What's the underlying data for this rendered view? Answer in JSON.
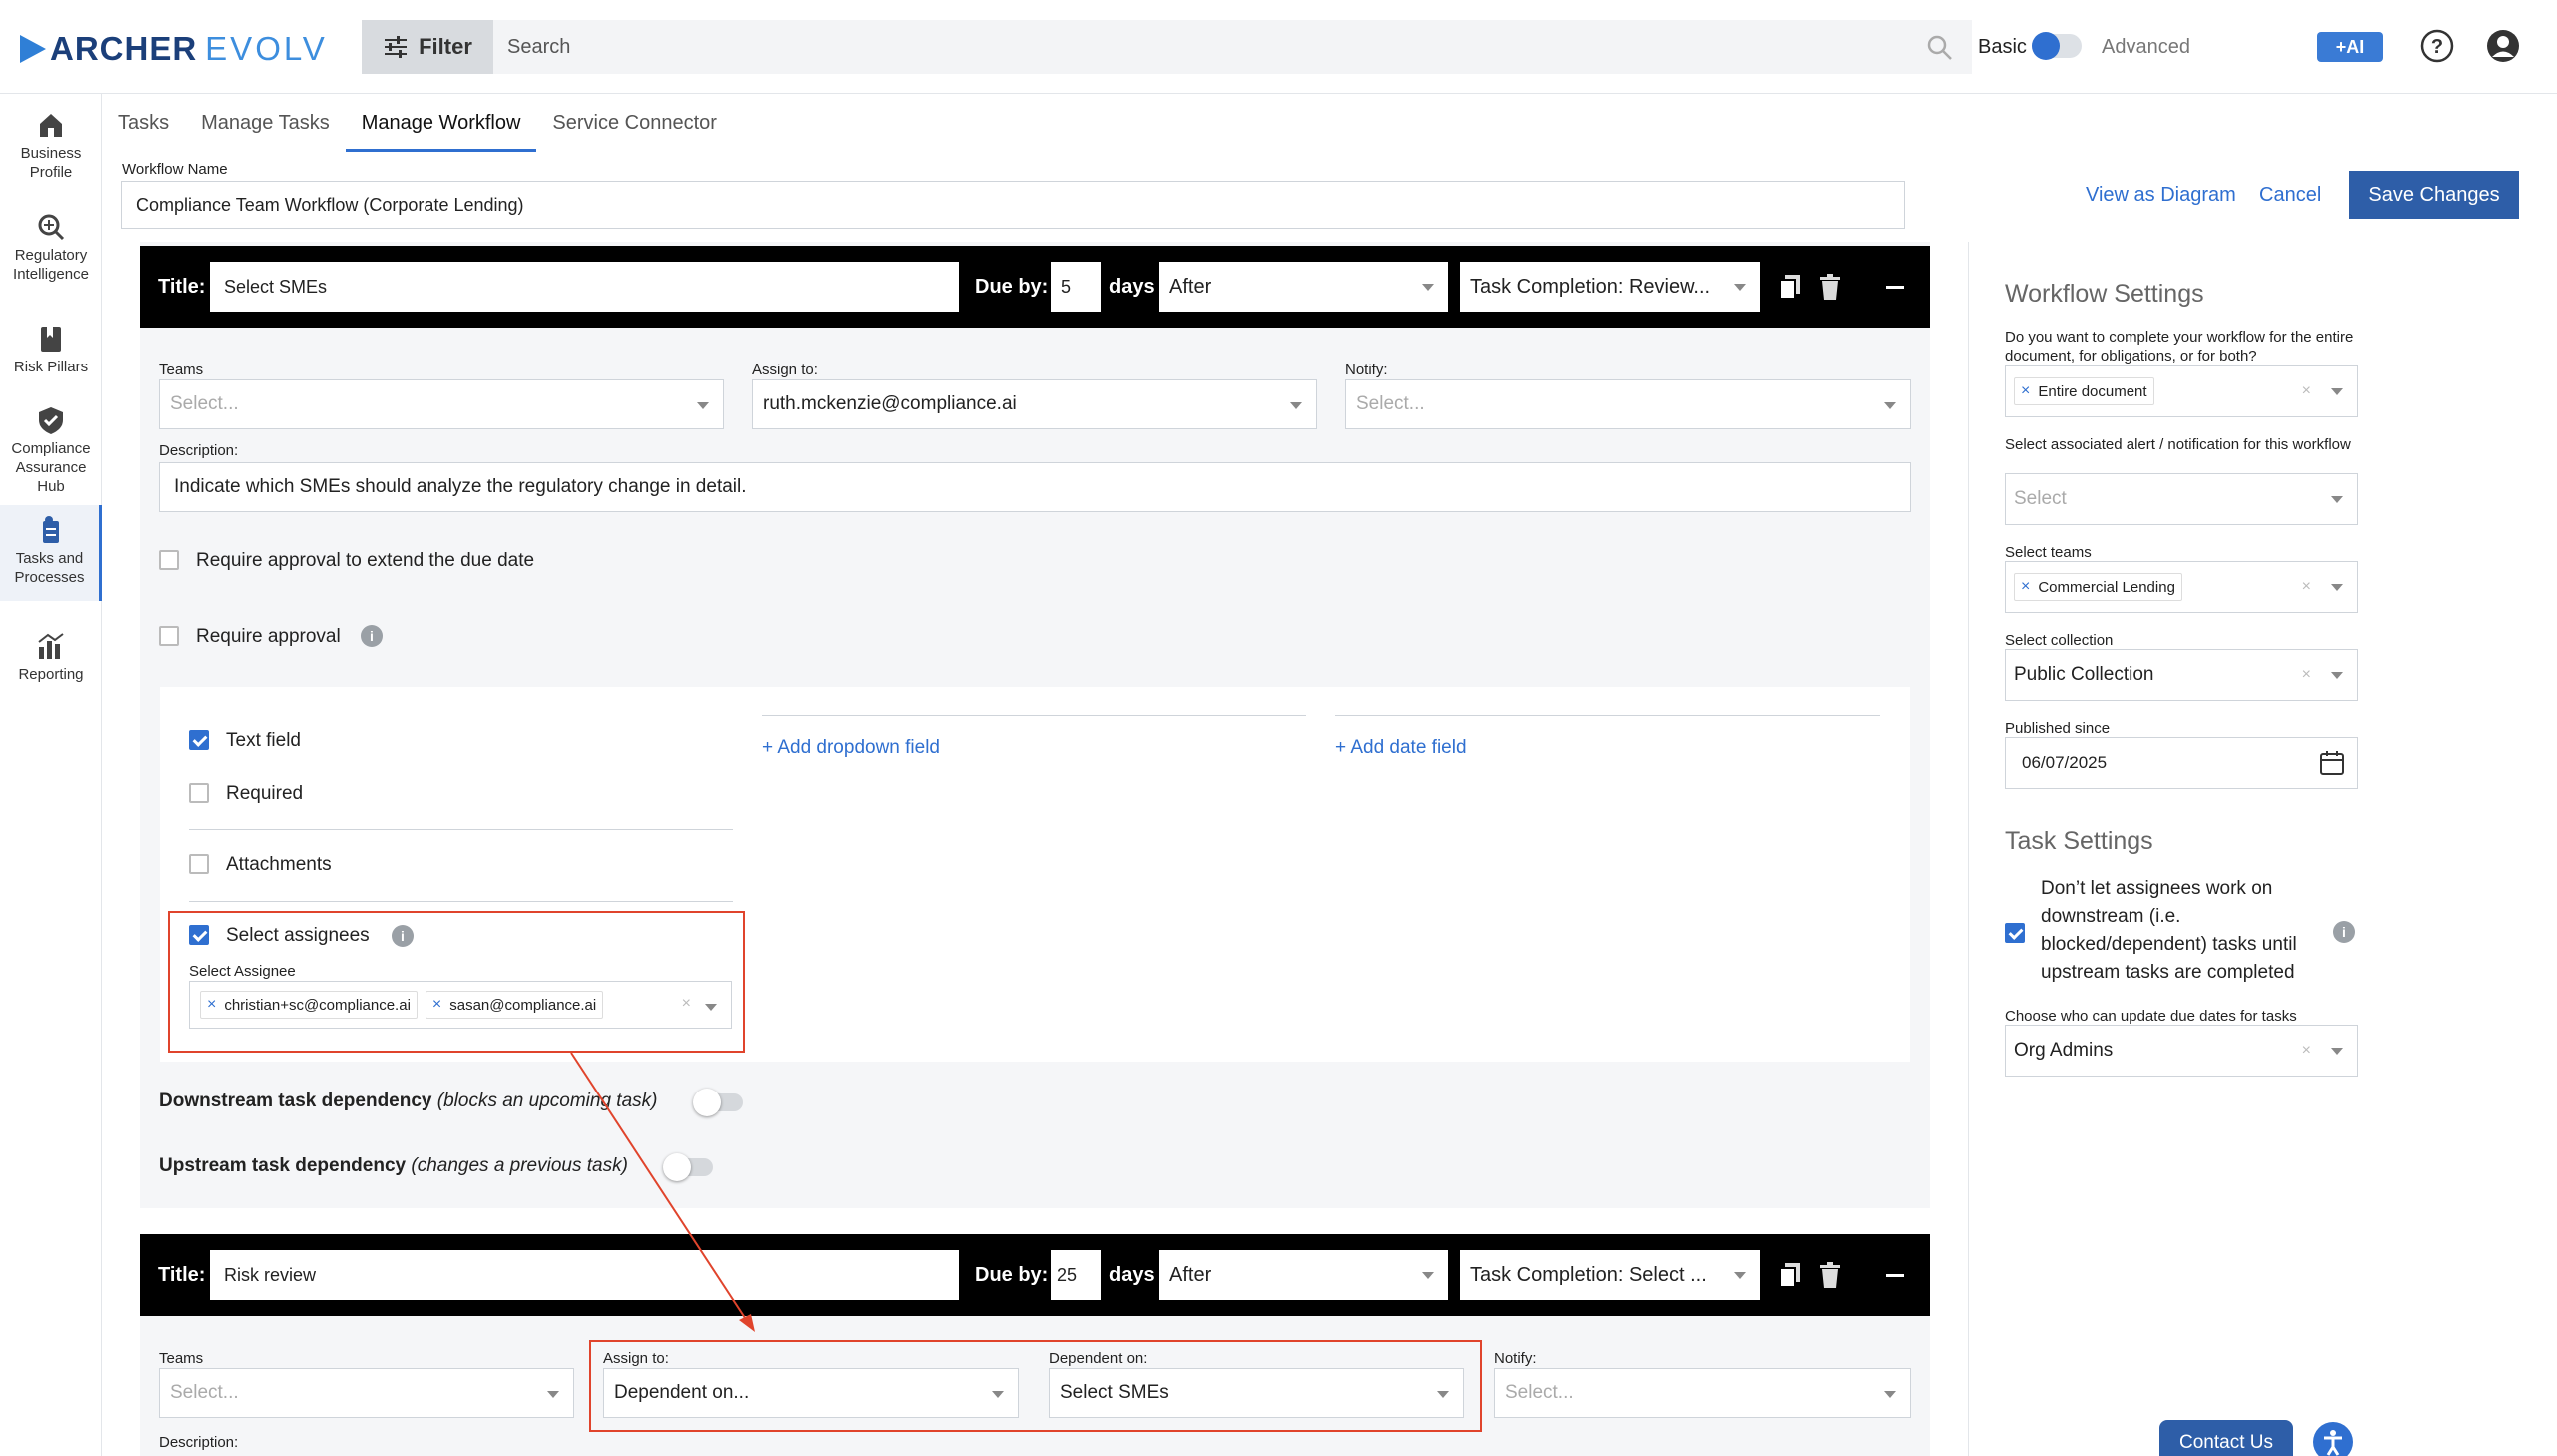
{
  "app": {
    "logo_main": "ARCHER",
    "logo_sub": "EVOLV",
    "filter_label": "Filter",
    "search_placeholder": "Search",
    "mode_basic": "Basic",
    "mode_advanced": "Advanced",
    "ai_label": "+AI"
  },
  "nav": [
    {
      "label1": "Business",
      "label2": "Profile",
      "label3": "",
      "icon": "building-icon"
    },
    {
      "label1": "Regulatory",
      "label2": "Intelligence",
      "label3": "",
      "icon": "magnifier-icon"
    },
    {
      "label1": "Risk Pillars",
      "label2": "",
      "label3": "",
      "icon": "bookmark-icon"
    },
    {
      "label1": "Compliance",
      "label2": "Assurance",
      "label3": "Hub",
      "icon": "shield-check-icon"
    },
    {
      "label1": "Tasks and",
      "label2": "Processes",
      "label3": "",
      "icon": "tasks-icon",
      "active": true
    },
    {
      "label1": "Reporting",
      "label2": "",
      "label3": "",
      "icon": "chart-icon"
    }
  ],
  "tabs": [
    "Tasks",
    "Manage Tasks",
    "Manage Workflow",
    "Service Connector"
  ],
  "workflow": {
    "name_label": "Workflow Name",
    "name_value": "Compliance Team Workflow (Corporate Lending)",
    "view_diagram": "View as Diagram",
    "cancel": "Cancel",
    "save": "Save Changes"
  },
  "task1": {
    "title_label": "Title:",
    "title_value": "Select SMEs",
    "due_label": "Due by:",
    "due_value": "5",
    "days_label": "days",
    "timing": "After",
    "trigger": "Task Completion: Review...",
    "teams_label": "Teams",
    "teams_placeholder": "Select...",
    "assign_label": "Assign to:",
    "assign_value": "ruth.mckenzie@compliance.ai",
    "notify_label": "Notify:",
    "notify_placeholder": "Select...",
    "desc_label": "Description:",
    "desc_value": "Indicate which SMEs should analyze the regulatory change in detail.",
    "req_extend_label": "Require approval to extend the due date",
    "req_approval_label": "Require approval",
    "text_field_label": "Text field",
    "required_label": "Required",
    "attachments_label": "Attachments",
    "select_assignees_label": "Select assignees",
    "select_assignee_label": "Select Assignee",
    "assignees": [
      "christian+sc@compliance.ai",
      "sasan@compliance.ai"
    ],
    "add_dropdown": "+ Add dropdown field",
    "add_date": "+ Add date field",
    "downstream_bold": "Downstream task dependency",
    "downstream_italic": "(blocks an upcoming task)",
    "upstream_bold": "Upstream task dependency",
    "upstream_italic": "(changes a previous task)"
  },
  "task2": {
    "title_label": "Title:",
    "title_value": "Risk review",
    "due_label": "Due by:",
    "due_value": "25",
    "days_label": "days",
    "timing": "After",
    "trigger": "Task Completion: Select ...",
    "teams_label": "Teams",
    "teams_placeholder": "Select...",
    "assign_label": "Assign to:",
    "assign_value": "Dependent on...",
    "dependent_label": "Dependent on:",
    "dependent_value": "Select SMEs",
    "notify_label": "Notify:",
    "notify_placeholder": "Select...",
    "desc_label": "Description:"
  },
  "settings": {
    "workflow_title": "Workflow Settings",
    "q1_label": "Do you want to complete your workflow for the entire document, for obligations, or for both?",
    "q1_value": "Entire document",
    "q2_label": "Select associated alert / notification for this workflow",
    "q2_placeholder": "Select",
    "q3_label": "Select teams",
    "q3_value": "Commercial Lending",
    "q4_label": "Select collection",
    "q4_value": "Public Collection",
    "q5_label": "Published since",
    "q5_value": "06/07/2025",
    "task_title": "Task Settings",
    "ts1_line1": "Don’t let assignees work on",
    "ts1_line2": "downstream (i.e.",
    "ts1_line3": "blocked/dependent) tasks until",
    "ts1_line4": "upstream tasks are completed",
    "ts2_label": "Choose who can update due dates for tasks",
    "ts2_value": "Org Admins"
  },
  "footer": {
    "contact": "Contact Us"
  },
  "colors": {
    "accent": "#2f6fd0",
    "primary_button": "#2e5ea8",
    "annotation": "#e0442c"
  }
}
